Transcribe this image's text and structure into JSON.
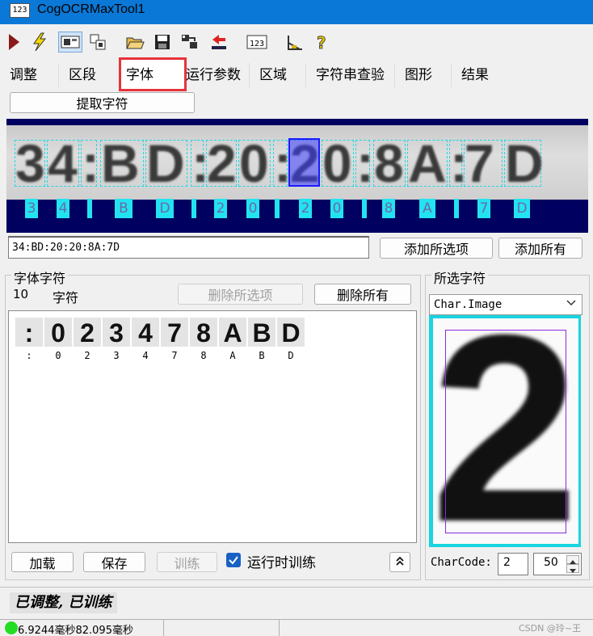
{
  "window": {
    "title": "CogOCRMaxTool1",
    "icon_text": "123"
  },
  "toolbar": {
    "items": [
      "run-icon",
      "lightning-icon",
      "image-display-icon",
      "tool-windows-icon",
      "open-icon",
      "save-icon",
      "export-icon",
      "import-icon",
      "ocr-123-icon",
      "calibration-icon",
      "help-icon"
    ]
  },
  "tabs": [
    "调整",
    "区段",
    "字体",
    "运行参数",
    "区域",
    "字符串查验",
    "图形",
    "结果"
  ],
  "active_tab": "字体",
  "extract_button": "提取字符",
  "image": {
    "text": [
      "3",
      "4",
      ":",
      "B",
      "D",
      ":",
      "2",
      "0",
      ":",
      "2",
      "0",
      ":",
      "8",
      "A",
      ":",
      "7",
      "D"
    ],
    "labels": [
      "3",
      "4",
      "|",
      "B",
      "D",
      "|",
      "2",
      "0",
      "|",
      "2",
      "0",
      "|",
      "8",
      "A",
      "|",
      "7",
      "D"
    ],
    "selected_index": 9
  },
  "result_text": "34:BD:20:20:8A:7D",
  "add_selected_button": "添加所选项",
  "add_all_button": "添加所有",
  "font_group": {
    "title": "字体字符",
    "count": "10",
    "count_label": "字符",
    "delete_selected_button": "删除所选项",
    "delete_all_button": "删除所有",
    "glyphs": [
      ":",
      "0",
      "2",
      "3",
      "4",
      "7",
      "8",
      "A",
      "B",
      "D"
    ]
  },
  "selected_group": {
    "title": "所选字符",
    "dropdown_value": "Char.Image",
    "big_char": "2",
    "charcode_label": "CharCode:",
    "charcode_value": "2",
    "spin_value": "50"
  },
  "buttons": {
    "load": "加载",
    "save": "保存",
    "train": "训练"
  },
  "train_checkbox_label": "运行时训练",
  "status_message": "已调整, 已训练",
  "timing_text": "6.9244毫秒82.095毫秒",
  "watermark": "CSDN @玲~王",
  "colors": {
    "titlebar": "#0a78d7",
    "accent_red": "#e8323a",
    "region_bg": "#000060",
    "cyan": "#23d7e6"
  }
}
